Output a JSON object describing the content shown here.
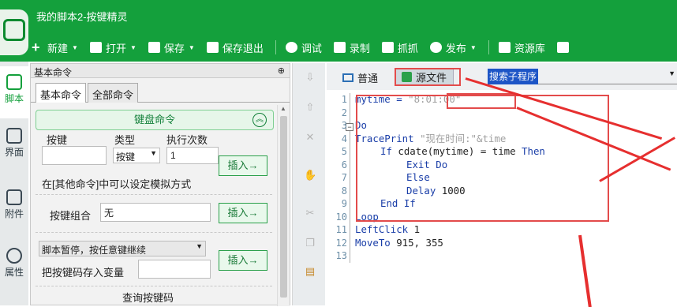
{
  "app": {
    "title": "我的脚本2-按键精灵"
  },
  "toolbar": [
    {
      "label": "新建",
      "dropdown": true,
      "icon": "plus-icon"
    },
    {
      "label": "打开",
      "dropdown": true,
      "icon": "folder-icon"
    },
    {
      "label": "保存",
      "dropdown": true,
      "icon": "save-icon"
    },
    {
      "label": "保存退出",
      "dropdown": false,
      "icon": "save-exit-icon"
    },
    {
      "label": "调试",
      "dropdown": false,
      "icon": "play-icon"
    },
    {
      "label": "录制",
      "dropdown": false,
      "icon": "record-icon"
    },
    {
      "label": "抓抓",
      "dropdown": false,
      "icon": "capture-icon"
    },
    {
      "label": "发布",
      "dropdown": true,
      "icon": "publish-icon"
    },
    {
      "label": "资源库",
      "dropdown": false,
      "icon": "library-icon"
    }
  ],
  "sidebar": [
    {
      "label": "脚本",
      "icon": "script-icon",
      "active": true
    },
    {
      "label": "界面",
      "icon": "ui-icon",
      "active": false
    },
    {
      "label": "附件",
      "icon": "attachment-icon",
      "active": false
    },
    {
      "label": "属性",
      "icon": "info-icon",
      "active": false
    }
  ],
  "left_panel": {
    "title": "基本命令",
    "pin": "⊕",
    "tabs": [
      "基本命令",
      "全部命令"
    ],
    "keyboard": {
      "header": "键盘命令",
      "key_label": "按键",
      "type_label": "类型",
      "count_label": "执行次数",
      "type_value": "按键",
      "count_value": "1",
      "insert": "插入→",
      "hint": "在[其他命令]中可以设定模拟方式",
      "combo_label": "按键组合",
      "combo_value": "无",
      "insert2": "插入→",
      "pause_option": "脚本暂停，按任意键继续",
      "store_label": "把按键码存入变量",
      "insert3": "插入→",
      "query_label": "查询按键码"
    }
  },
  "editor": {
    "mode_normal": "普通",
    "mode_source": "源文件",
    "search_placeholder": "搜索子程序",
    "lines": [
      "1",
      "2",
      "3",
      "4",
      "5",
      "6",
      "7",
      "8",
      "9",
      "10",
      "11",
      "12",
      "13"
    ],
    "code": {
      "l1_a": "mytime = ",
      "l1_b": "\"8:01:00\"",
      "l3": "Do",
      "l4_a": "TracePrint ",
      "l4_b": "\"现在时间:\"&time",
      "l5_a": "If ",
      "l5_b": "cdate(mytime) = time ",
      "l5_c": "Then",
      "l6": "Exit Do",
      "l7": "Else",
      "l8_a": "Delay ",
      "l8_b": "1000",
      "l9": "End If",
      "l10": "Loop",
      "l11_a": "LeftClick ",
      "l11_b": "1",
      "l12_a": "MoveTo ",
      "l12_b": "915, 355"
    }
  },
  "colors": {
    "brand_green": "#14a03c",
    "highlight_red": "#e34b4b",
    "keyword_blue": "#1a3ea8"
  }
}
